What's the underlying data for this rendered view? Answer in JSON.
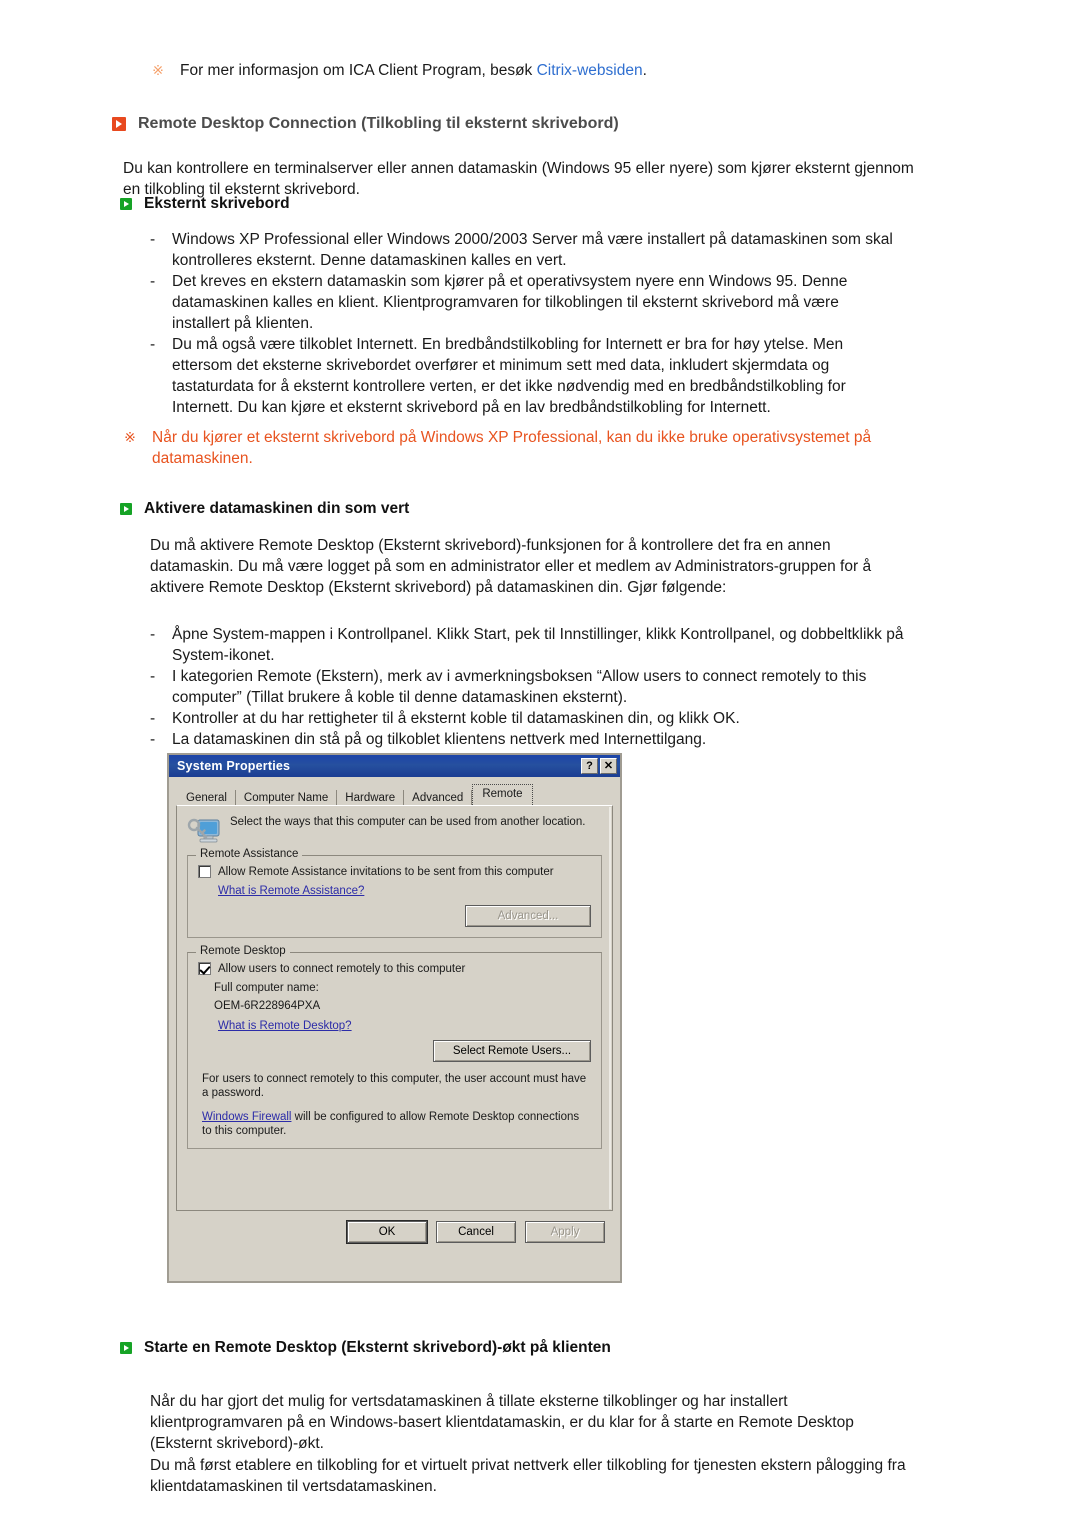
{
  "top_note": {
    "marker": "※",
    "text_before": "For mer informasjon om ICA Client Program, besøk ",
    "link_text": "Citrix-websiden",
    "text_after": ".",
    "link_color": "#2f6fd0",
    "marker_color": "#f5a06a"
  },
  "main_heading": {
    "text": "Remote Desktop Connection (Tilkobling til eksternt skrivebord)",
    "bullet_color": "#e8491f",
    "text_color": "#4c4c4c"
  },
  "intro_paragraph": "Du kan kontrollere en terminalserver eller annen datamaskin (Windows 95 eller nyere) som kjører eksternt gjennom en tilkobling til eksternt skrivebord.",
  "sub_heading_1": {
    "text": "Eksternt skrivebord",
    "bullet_color": "#16a326"
  },
  "list_1": [
    "Windows XP Professional eller Windows 2000/2003 Server må være installert på datamaskinen som skal kontrolleres eksternt. Denne datamaskinen kalles en vert.",
    "Det kreves en ekstern datamaskin som kjører på et operativsystem nyere enn Windows 95. Denne datamaskinen kalles en klient. Klientprogramvaren for tilkoblingen til eksternt skrivebord må være installert på klienten.",
    "Du må også være tilkoblet Internett. En bredbåndstilkobling for Internett er bra for høy ytelse. Men ettersom det eksterne skrivebordet overfører et minimum sett med data, inkludert skjermdata og tastaturdata for å eksternt kontrollere verten, er det ikke nødvendig med en bredbåndstilkobling for Internett. Du kan kjøre et eksternt skrivebord på en lav bredbåndstilkobling for Internett."
  ],
  "warning_note": {
    "marker": "※",
    "text": "Når du kjører et eksternt skrivebord på Windows XP Professional, kan du ikke bruke operativsystemet på datamaskinen.",
    "color": "#e8531f"
  },
  "sub_heading_2": {
    "text": "Aktivere datamaskinen din som vert",
    "bullet_color": "#16a326"
  },
  "paragraph_2": "Du må aktivere Remote Desktop (Eksternt skrivebord)-funksjonen for å kontrollere det fra en annen datamaskin. Du må være logget på som en administrator eller et medlem av Administrators-gruppen for å aktivere Remote Desktop (Eksternt skrivebord) på datamaskinen din. Gjør følgende:",
  "list_2": [
    "Åpne System-mappen i Kontrollpanel. Klikk Start, pek til Innstillinger, klikk Kontrollpanel, og dobbeltklikk på System-ikonet.",
    "I kategorien Remote (Ekstern), merk av i avmerkningsboksen “Allow users to connect remotely to this computer” (Tillat brukere å koble til denne datamaskinen eksternt).",
    "Kontroller at du har rettigheter til å eksternt koble til datamaskinen din, og klikk OK.",
    "La datamaskinen din stå på og tilkoblet klientens nettverk med Internettilgang."
  ],
  "dialog": {
    "title": "System Properties",
    "help_button": "?",
    "close_button": "✕",
    "tabs": [
      {
        "label": "General",
        "active": false
      },
      {
        "label": "Computer Name",
        "active": false
      },
      {
        "label": "Hardware",
        "active": false
      },
      {
        "label": "Advanced",
        "active": false
      },
      {
        "label": "Remote",
        "active": true
      }
    ],
    "intro_text": "Select the ways that this computer can be used from another location.",
    "remote_assistance": {
      "group_title": "Remote Assistance",
      "checkbox_label": "Allow Remote Assistance invitations to be sent from this computer",
      "checkbox_checked": false,
      "link": "What is Remote Assistance?",
      "button": "Advanced...",
      "button_disabled": true
    },
    "remote_desktop": {
      "group_title": "Remote Desktop",
      "checkbox_label": "Allow users to connect remotely to this computer",
      "checkbox_checked": true,
      "name_label": "Full computer name:",
      "name_value": "OEM-6R228964PXA",
      "link": "What is Remote Desktop?",
      "button": "Select Remote Users...",
      "note_1": "For users to connect remotely to this computer, the user account must have a password.",
      "note_2_link": "Windows Firewall",
      "note_2_rest": " will be configured to allow Remote Desktop connections to this computer."
    },
    "footer": {
      "ok": "OK",
      "cancel": "Cancel",
      "apply": "Apply",
      "apply_disabled": true
    }
  },
  "sub_heading_3": {
    "text": "Starte en Remote Desktop (Eksternt skrivebord)-økt på klienten",
    "bullet_color": "#16a326"
  },
  "paragraph_3": "Når du har gjort det mulig for vertsdatamaskinen å tillate eksterne tilkoblinger og har installert klientprogramvaren på en Windows-basert klientdatamaskin, er du klar for å starte en Remote Desktop (Eksternt skrivebord)-økt.",
  "paragraph_4": "Du må først etablere en tilkobling for et virtuelt privat nettverk eller tilkobling for tjenesten ekstern pålogging fra klientdatamaskinen til vertsdatamaskinen."
}
